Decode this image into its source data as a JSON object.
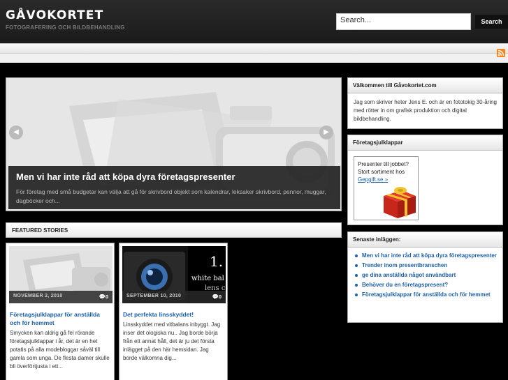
{
  "header": {
    "logo": "GÅVOKORTET",
    "tagline": "FOTOGRAFERING OCH BILDBEHANDLING",
    "search_placeholder": "Search...",
    "search_button": "Search",
    "rss_icon": "rss-icon"
  },
  "slider": {
    "title": "Men vi har inte råd att köpa dyra företagspresenter",
    "excerpt": "För företag med små budgetar kan välja att gå för skrivbord objekt som kalendrar, leksaker skrivbord, pennor, muggar, dagböcker och...",
    "prev_icon": "arrow-left-icon",
    "next_icon": "arrow-right-icon"
  },
  "featured": {
    "heading": "FEATURED STORIES",
    "cards": [
      {
        "date": "NOVEMBER 2, 2010",
        "comments": "0",
        "title": "Företagsjulklappar för anställda och för hemmet",
        "text": "Smycken kan aldrig gå fel rörande företagsjulklappar i år, det är en het potatis på alla modebloggar såväl till gamla som unga. De flesta damer skulle bli överförtjusta i ett..."
      },
      {
        "date": "SEPTEMBER 10, 2010",
        "comments": "0",
        "title": "Det perfekta linsskyddet!",
        "text": "Linsskyddet med vitbalans inbyggt. Jag inser det ologiska nu.. Jag borde börja från ett annat håll, det är ju det första inlägget på den här hemsidan. Jag borde välkomna dig...",
        "image_text": {
          "number": "1.",
          "line1": "white bal",
          "line2": "lens ca"
        }
      }
    ]
  },
  "sidebar": {
    "welcome": {
      "title": "Välkommen till Gåvokortet.com",
      "text": "Jag som skriver heter Jens E. och är en fototokig 30-åring med rötter in om grafisk produktion och digital bildbehandling."
    },
    "ad_widget": {
      "title": "Företagsjulklappar",
      "text": "Presenter till jobbet? Stort sortiment hos",
      "link": "Gepgift.se »",
      "image_icon": "gift-icon"
    },
    "recent": {
      "title": "Senaste inläggen:",
      "items": [
        "Men vi har inte råd att köpa dyra företagspresenter",
        "Trender inom presentbranschen",
        "ge dina anställda något användbart",
        "Behöver du en företagspresent?",
        "Företagsjulklappar för anställda och för hemmet"
      ]
    }
  },
  "colors": {
    "background": "#000000",
    "link": "#1a5fa8",
    "header": "#222222",
    "rss": "#f78422"
  }
}
